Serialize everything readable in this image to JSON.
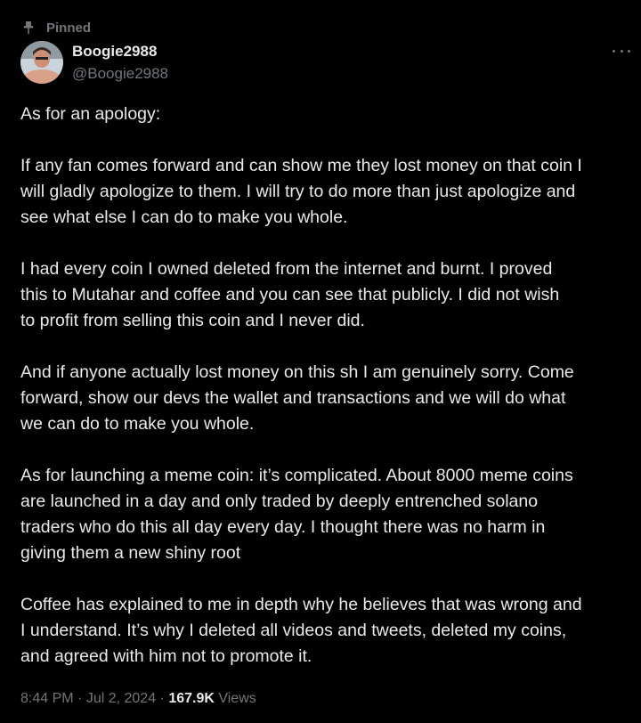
{
  "pinned_label": "Pinned",
  "author": {
    "name": "Boogie2988",
    "handle": "@Boogie2988"
  },
  "icons": {
    "pin": "pin-icon",
    "more": "more-icon",
    "avatar": "avatar"
  },
  "tweet": {
    "paragraphs": [
      "As for an apology:",
      "If any fan comes forward and can show me they lost money on that coin I\nwill gladly apologize to them.  I will try to do more than just apologize and\nsee what else I can do to make you whole.",
      "I had every coin I owned deleted from the internet and burnt. I proved\nthis to Mutahar and coffee and you can see that publicly.  I did not wish\nto profit from selling this coin and I never did.",
      "And if anyone actually lost money on this sh    I am genuinely sorry. Come\nforward, show our devs the wallet and transactions and we will do what\nwe can do to make you whole.",
      "As for launching a meme coin: it’s complicated. About 8000 meme coins\nare launched in a day and only traded by deeply entrenched solano\ntraders who do this all day every day.  I thought there was no harm in\ngiving them a new shiny root",
      "Coffee has explained to me in depth why he believes that was wrong and\nI understand. It’s why I deleted all videos and tweets, deleted my coins,\nand agreed with him not to promote it."
    ]
  },
  "meta": {
    "time": "8:44 PM",
    "sep1": " · ",
    "date": "Jul 2, 2024",
    "sep2": " · ",
    "views_count": "167.9K",
    "views_label": " Views"
  },
  "colors": {
    "background": "#000000",
    "text": "#e7e9ea",
    "muted": "#71767b"
  }
}
